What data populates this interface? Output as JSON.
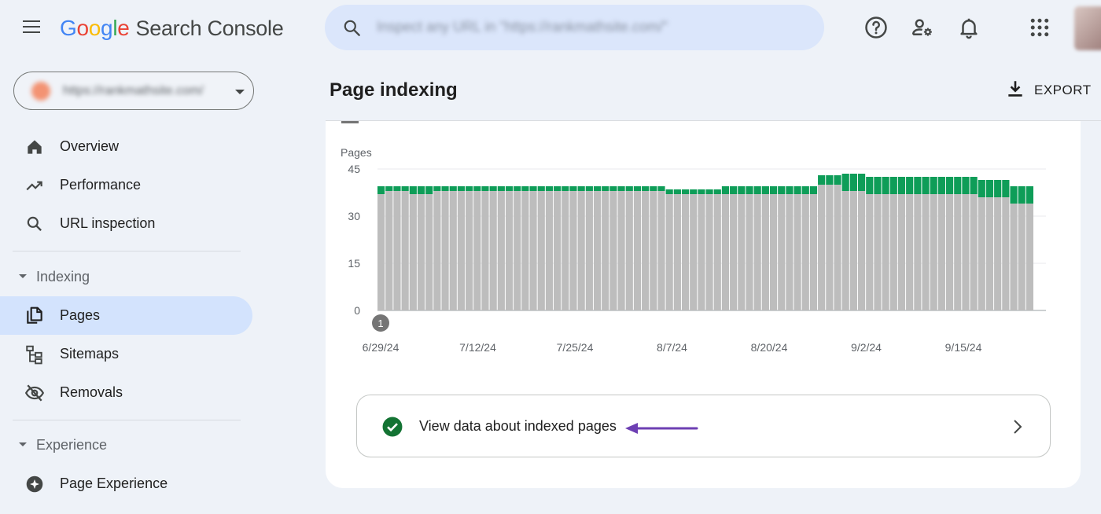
{
  "header": {
    "logo": {
      "letters": [
        "G",
        "o",
        "o",
        "g",
        "l",
        "e"
      ],
      "product": "Search Console"
    },
    "search": {
      "placeholder": "Inspect any URL in \"https://rankmathsite.com/\""
    },
    "icons": [
      "help-icon",
      "manage-users-icon",
      "notifications-icon",
      "apps-grid-icon"
    ]
  },
  "sidebar": {
    "property_url": "https://rankmathsite.com/",
    "items": [
      {
        "label": "Overview",
        "icon": "home-icon"
      },
      {
        "label": "Performance",
        "icon": "trending-up-icon"
      },
      {
        "label": "URL inspection",
        "icon": "search-icon"
      }
    ],
    "sections": [
      {
        "label": "Indexing",
        "items": [
          {
            "label": "Pages",
            "icon": "pages-icon",
            "active": true
          },
          {
            "label": "Sitemaps",
            "icon": "sitemap-icon"
          },
          {
            "label": "Removals",
            "icon": "eye-off-icon"
          }
        ]
      },
      {
        "label": "Experience",
        "items": [
          {
            "label": "Page Experience",
            "icon": "experience-icon"
          }
        ]
      }
    ]
  },
  "main": {
    "title": "Page indexing",
    "export_label": "EXPORT",
    "link_text": "View data about indexed pages",
    "annotation_marker": "1"
  },
  "colors": {
    "indexed": "#0e9d58",
    "not_indexed": "#bdbdbd",
    "active_nav": "#d3e3fd",
    "annotation_arrow": "#6d3fb3"
  },
  "chart_data": {
    "type": "bar",
    "stacked": true,
    "ylabel": "Pages",
    "ylim": [
      0,
      45
    ],
    "yticks": [
      0,
      15,
      30,
      45
    ],
    "grid": true,
    "xtick_labels": [
      "6/29/24",
      "7/12/24",
      "7/25/24",
      "8/7/24",
      "8/20/24",
      "9/2/24",
      "9/15/24"
    ],
    "series": [
      {
        "color": "#bdbdbd",
        "values": [
          37,
          38,
          38,
          38,
          37,
          37,
          37,
          38,
          38,
          38,
          38,
          38,
          38,
          38,
          38,
          38,
          38,
          38,
          38,
          38,
          38,
          38,
          38,
          38,
          38,
          38,
          38,
          38,
          38,
          38,
          38,
          38,
          38,
          38,
          38,
          38,
          37,
          37,
          37,
          37,
          37,
          37,
          37,
          37,
          37,
          37,
          37,
          37,
          37,
          37,
          37,
          37,
          37,
          37,
          37,
          40,
          40,
          40,
          38,
          38,
          38,
          37,
          37,
          37,
          37,
          37,
          37,
          37,
          37,
          37,
          37,
          37,
          37,
          37,
          37,
          36,
          36,
          36,
          36,
          34,
          34,
          34
        ]
      },
      {
        "color": "#0e9d58",
        "values": [
          2.5,
          1.5,
          1.5,
          1.5,
          2.5,
          2.5,
          2.5,
          1.5,
          1.5,
          1.5,
          1.5,
          1.5,
          1.5,
          1.5,
          1.5,
          1.5,
          1.5,
          1.5,
          1.5,
          1.5,
          1.5,
          1.5,
          1.5,
          1.5,
          1.5,
          1.5,
          1.5,
          1.5,
          1.5,
          1.5,
          1.5,
          1.5,
          1.5,
          1.5,
          1.5,
          1.5,
          1.5,
          1.5,
          1.5,
          1.5,
          1.5,
          1.5,
          1.5,
          2.5,
          2.5,
          2.5,
          2.5,
          2.5,
          2.5,
          2.5,
          2.5,
          2.5,
          2.5,
          2.5,
          2.5,
          3,
          3,
          3,
          5.5,
          5.5,
          5.5,
          5.5,
          5.5,
          5.5,
          5.5,
          5.5,
          5.5,
          5.5,
          5.5,
          5.5,
          5.5,
          5.5,
          5.5,
          5.5,
          5.5,
          5.5,
          5.5,
          5.5,
          5.5,
          5.5,
          5.5,
          5.5
        ]
      }
    ]
  }
}
